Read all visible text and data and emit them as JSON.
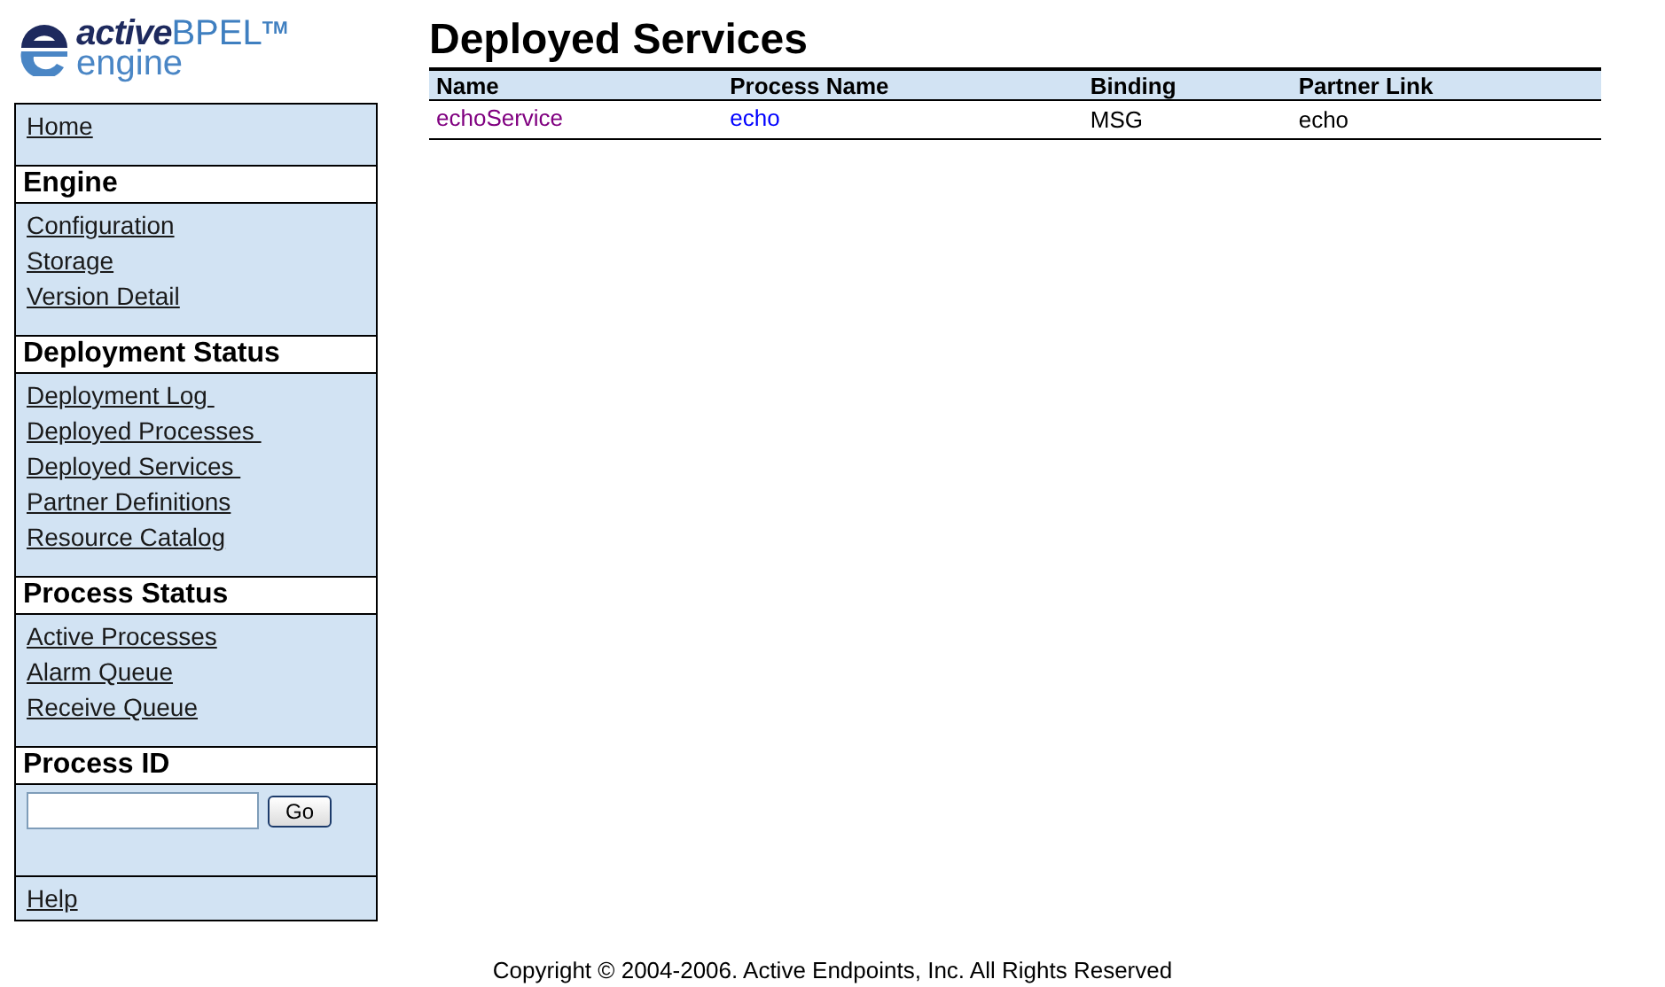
{
  "logo": {
    "brand_italic": "active",
    "brand": "BPEL",
    "trademark": "TM",
    "product": "engine"
  },
  "sidebar": {
    "sections": [
      {
        "kind": "links",
        "items": [
          "Home"
        ]
      },
      {
        "kind": "links",
        "heading": "Engine",
        "items": [
          "Configuration",
          "Storage",
          "Version Detail"
        ]
      },
      {
        "kind": "links",
        "heading": "Deployment Status",
        "items": [
          "Deployment Log ",
          "Deployed Processes ",
          "Deployed Services ",
          "Partner Definitions",
          "Resource Catalog"
        ]
      },
      {
        "kind": "links",
        "heading": "Process Status",
        "items": [
          "Active Processes",
          "Alarm Queue",
          "Receive Queue"
        ]
      },
      {
        "kind": "form",
        "heading": "Process ID",
        "button": "Go"
      },
      {
        "kind": "links",
        "items": [
          "Help"
        ]
      }
    ]
  },
  "page": {
    "title": "Deployed Services"
  },
  "table": {
    "columns": [
      "Name",
      "Process Name",
      "Binding",
      "Partner Link"
    ],
    "rows": [
      {
        "name": {
          "text": "echoService",
          "visited": true
        },
        "process_name": {
          "text": "echo",
          "visited": false
        },
        "binding": "MSG",
        "partner_link": "echo"
      }
    ]
  },
  "footer": "Copyright © 2004-2006. Active Endpoints, Inc. All Rights Reserved"
}
